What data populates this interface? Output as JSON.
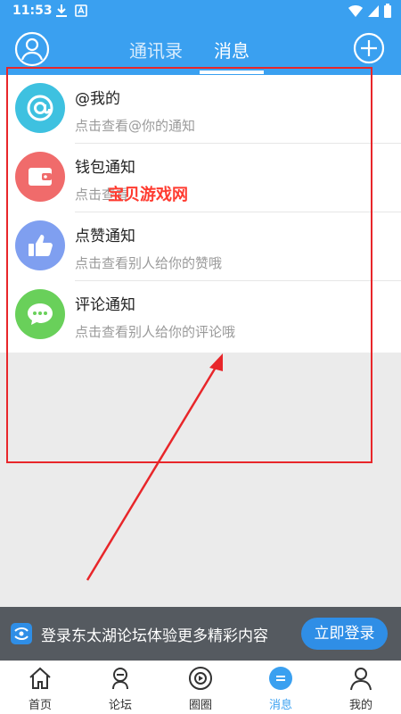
{
  "status_bar": {
    "time": "11:53"
  },
  "header": {
    "tabs": [
      {
        "label": "通讯录",
        "active": false
      },
      {
        "label": "消息",
        "active": true
      }
    ]
  },
  "notifications": [
    {
      "title": "@我的",
      "subtitle": "点击查看@你的通知",
      "icon": "at-icon",
      "color": "#3ec1e0"
    },
    {
      "title": "钱包通知",
      "subtitle": "点击查看",
      "icon": "wallet-icon",
      "color": "#f06b6b"
    },
    {
      "title": "点赞通知",
      "subtitle": "点击查看别人给你的赞哦",
      "icon": "thumbs-up-icon",
      "color": "#7f9ff0"
    },
    {
      "title": "评论通知",
      "subtitle": "点击查看别人给你的评论哦",
      "icon": "comment-icon",
      "color": "#69d05a"
    }
  ],
  "watermark": "宝贝游戏网",
  "login_banner": {
    "text": "登录东太湖论坛体验更多精彩内容",
    "button": "立即登录"
  },
  "bottom_nav": [
    {
      "label": "首页",
      "icon": "home-icon",
      "active": false
    },
    {
      "label": "论坛",
      "icon": "forum-icon",
      "active": false
    },
    {
      "label": "圈圈",
      "icon": "circle-icon",
      "active": false
    },
    {
      "label": "消息",
      "icon": "message-icon",
      "active": true
    },
    {
      "label": "我的",
      "icon": "profile-icon",
      "active": false
    }
  ],
  "colors": {
    "accent": "#3aa0f0",
    "annotation": "#e8262a"
  }
}
